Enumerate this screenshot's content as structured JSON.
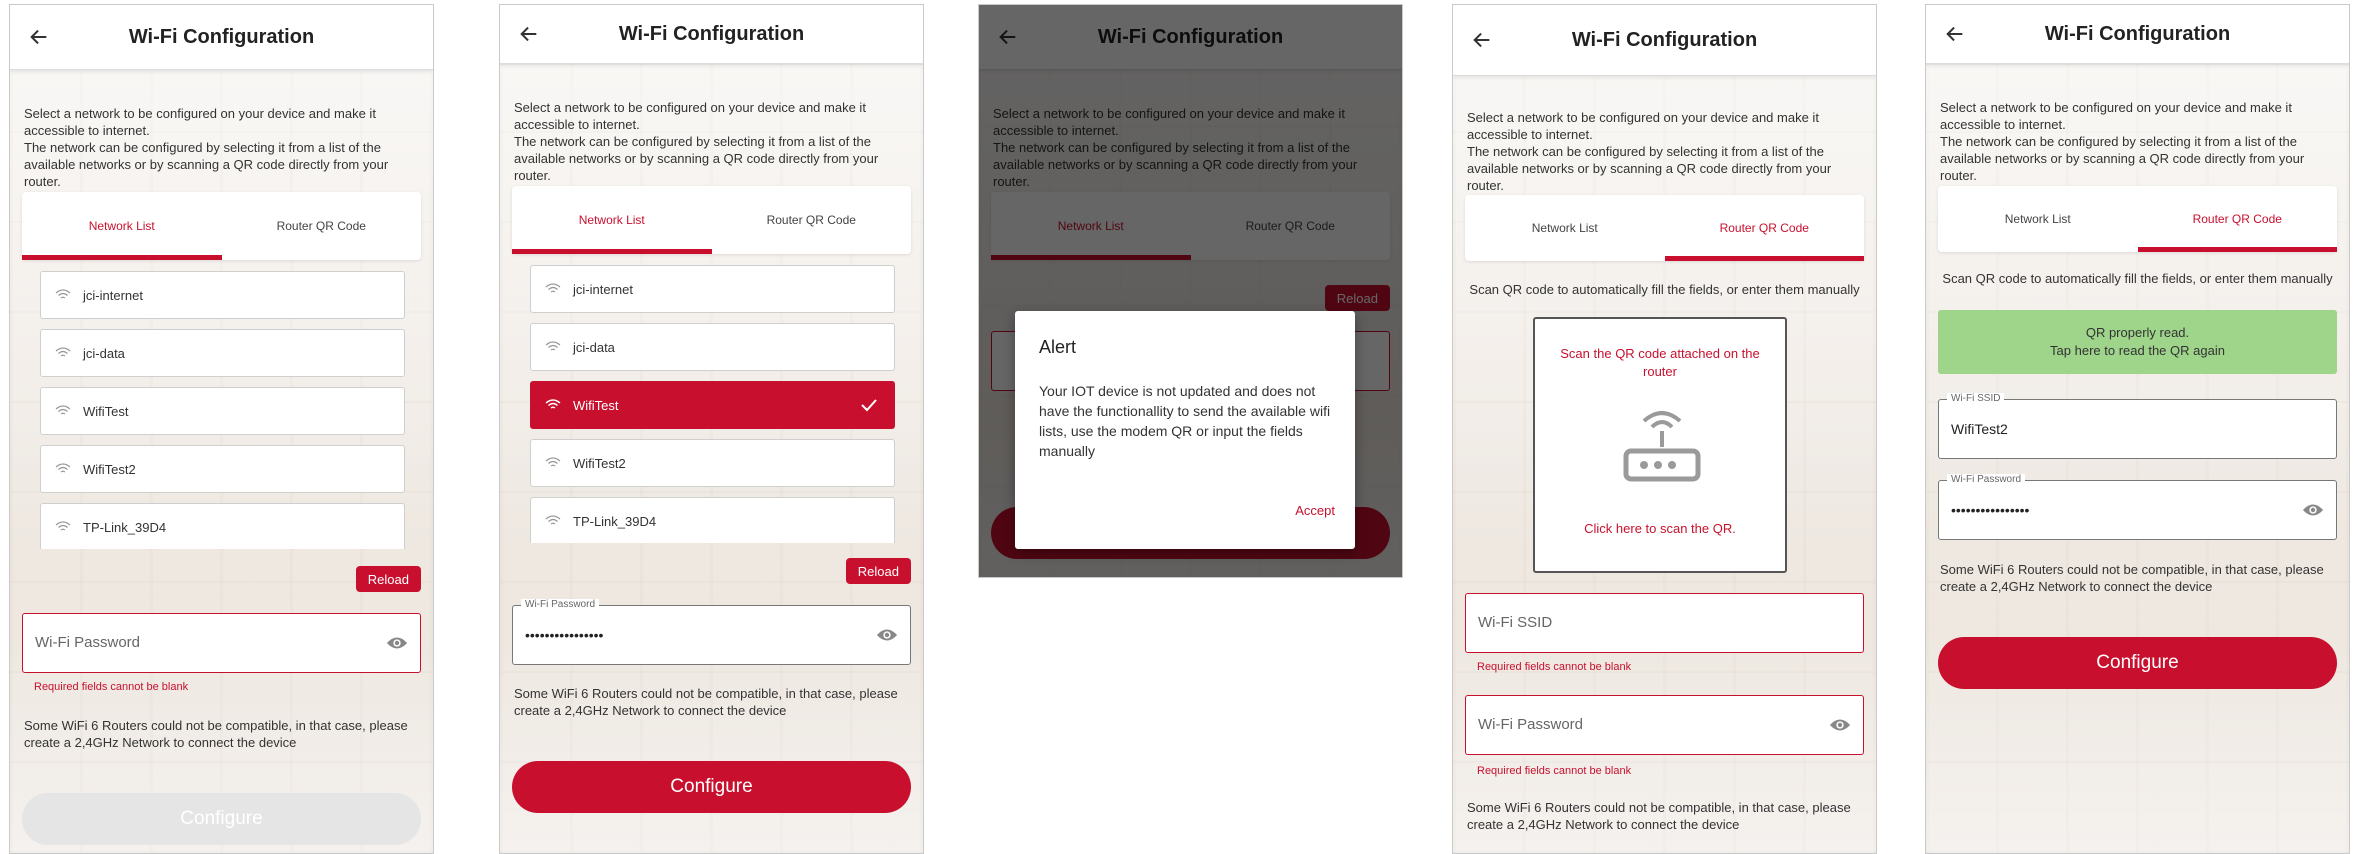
{
  "app": {
    "title": "Wi-Fi Configuration",
    "intro_line1": "Select a network to be configured on your device and make it accessible to internet.",
    "intro_line2": "The network can be configured by selecting it from a list of the available networks or by scanning a QR code directly from your router."
  },
  "tabs": {
    "network_list": "Network List",
    "router_qr": "Router QR Code"
  },
  "networks": [
    "jci-internet",
    "jci-data",
    "WifiTest",
    "WifiTest2",
    "TP-Link_39D4"
  ],
  "reload_label": "Reload",
  "password": {
    "placeholder": "Wi-Fi Password",
    "label": "Wi-Fi Password",
    "masked_value": "••••••••••••••••"
  },
  "ssid": {
    "placeholder": "Wi-Fi SSID",
    "label": "Wi-Fi SSID",
    "value": "WifiTest2"
  },
  "errors": {
    "required": "Required fields cannot be blank"
  },
  "note": "Some WiFi 6 Routers could not be compatible, in that case, please create a 2,4GHz Network to connect the device",
  "configure_label": "Configure",
  "qr": {
    "help": "Scan QR code to automatically fill the fields, or enter them manually",
    "scan_top": "Scan the QR code attached on the router",
    "scan_bottom": "Click here to scan the QR.",
    "read_ok_line1": "QR properly read.",
    "read_ok_line2": "Tap here to read the QR again"
  },
  "alert": {
    "title": "Alert",
    "message": "Your IOT device is not updated and does not have the functionallity to send the available wifi lists, use the modem QR or input the fields manually",
    "accept": "Accept"
  },
  "colors": {
    "accent": "#c8102e",
    "success": "#9fd48b",
    "disabled": "#e5e5e5"
  },
  "screen2": {
    "selected_network": "WifiTest"
  }
}
